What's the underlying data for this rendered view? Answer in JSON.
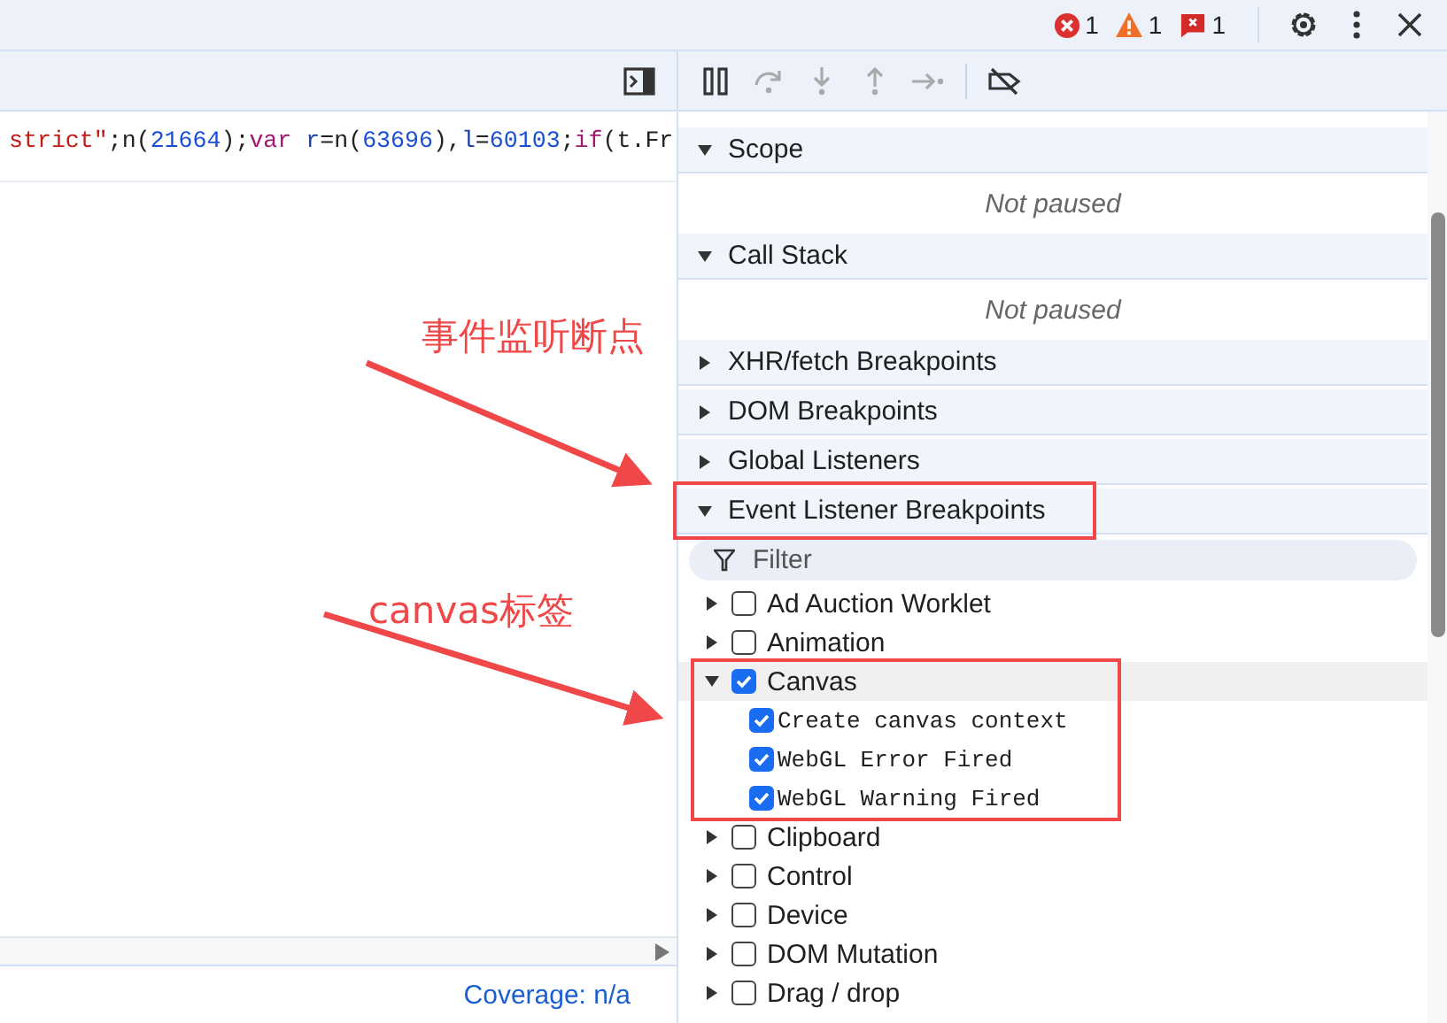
{
  "top_bar": {
    "counters": [
      {
        "kind": "error",
        "count": "1"
      },
      {
        "kind": "warning",
        "count": "1"
      },
      {
        "kind": "issue",
        "count": "1"
      }
    ]
  },
  "code_line": [
    {
      "kind": "string",
      "text": "strict\""
    },
    {
      "kind": "plain",
      "text": ";n("
    },
    {
      "kind": "number",
      "text": "21664"
    },
    {
      "kind": "plain",
      "text": ");"
    },
    {
      "kind": "keyword",
      "text": "var"
    },
    {
      "kind": "variable",
      "text": " r"
    },
    {
      "kind": "plain",
      "text": "=n("
    },
    {
      "kind": "number",
      "text": "63696"
    },
    {
      "kind": "plain",
      "text": "),"
    },
    {
      "kind": "variable",
      "text": "l"
    },
    {
      "kind": "plain",
      "text": "="
    },
    {
      "kind": "number",
      "text": "60103"
    },
    {
      "kind": "plain",
      "text": ";"
    },
    {
      "kind": "keyword",
      "text": "if"
    },
    {
      "kind": "plain",
      "text": "(t.Fr"
    }
  ],
  "status_bar": {
    "coverage": "Coverage: n/a"
  },
  "sidebar": [
    {
      "kind": "header",
      "label": "Scope",
      "expanded": true
    },
    {
      "kind": "message",
      "label": "Not paused"
    },
    {
      "kind": "header",
      "label": "Call Stack",
      "expanded": true
    },
    {
      "kind": "message",
      "label": "Not paused"
    },
    {
      "kind": "header",
      "label": "XHR/fetch Breakpoints",
      "expanded": false
    },
    {
      "kind": "header",
      "label": "DOM Breakpoints",
      "expanded": false
    },
    {
      "kind": "header",
      "label": "Global Listeners",
      "expanded": false
    },
    {
      "kind": "header",
      "label": "Event Listener Breakpoints",
      "expanded": true
    }
  ],
  "filter": {
    "placeholder": "Filter"
  },
  "categories": [
    {
      "label": "Ad Auction Worklet",
      "checked": false,
      "expanded": false,
      "selected": false
    },
    {
      "label": "Animation",
      "checked": false,
      "expanded": false,
      "selected": false
    },
    {
      "label": "Canvas",
      "checked": true,
      "expanded": true,
      "selected": true,
      "children": [
        {
          "label": "Create canvas context",
          "checked": true
        },
        {
          "label": "WebGL Error Fired",
          "checked": true
        },
        {
          "label": "WebGL Warning Fired",
          "checked": true
        }
      ]
    },
    {
      "label": "Clipboard",
      "checked": false,
      "expanded": false,
      "selected": false
    },
    {
      "label": "Control",
      "checked": false,
      "expanded": false,
      "selected": false
    },
    {
      "label": "Device",
      "checked": false,
      "expanded": false,
      "selected": false
    },
    {
      "label": "DOM Mutation",
      "checked": false,
      "expanded": false,
      "selected": false
    },
    {
      "label": "Drag / drop",
      "checked": false,
      "expanded": false,
      "selected": false
    }
  ],
  "annotations": [
    {
      "text": "事件监听断点"
    },
    {
      "text": "canvas标签"
    }
  ]
}
